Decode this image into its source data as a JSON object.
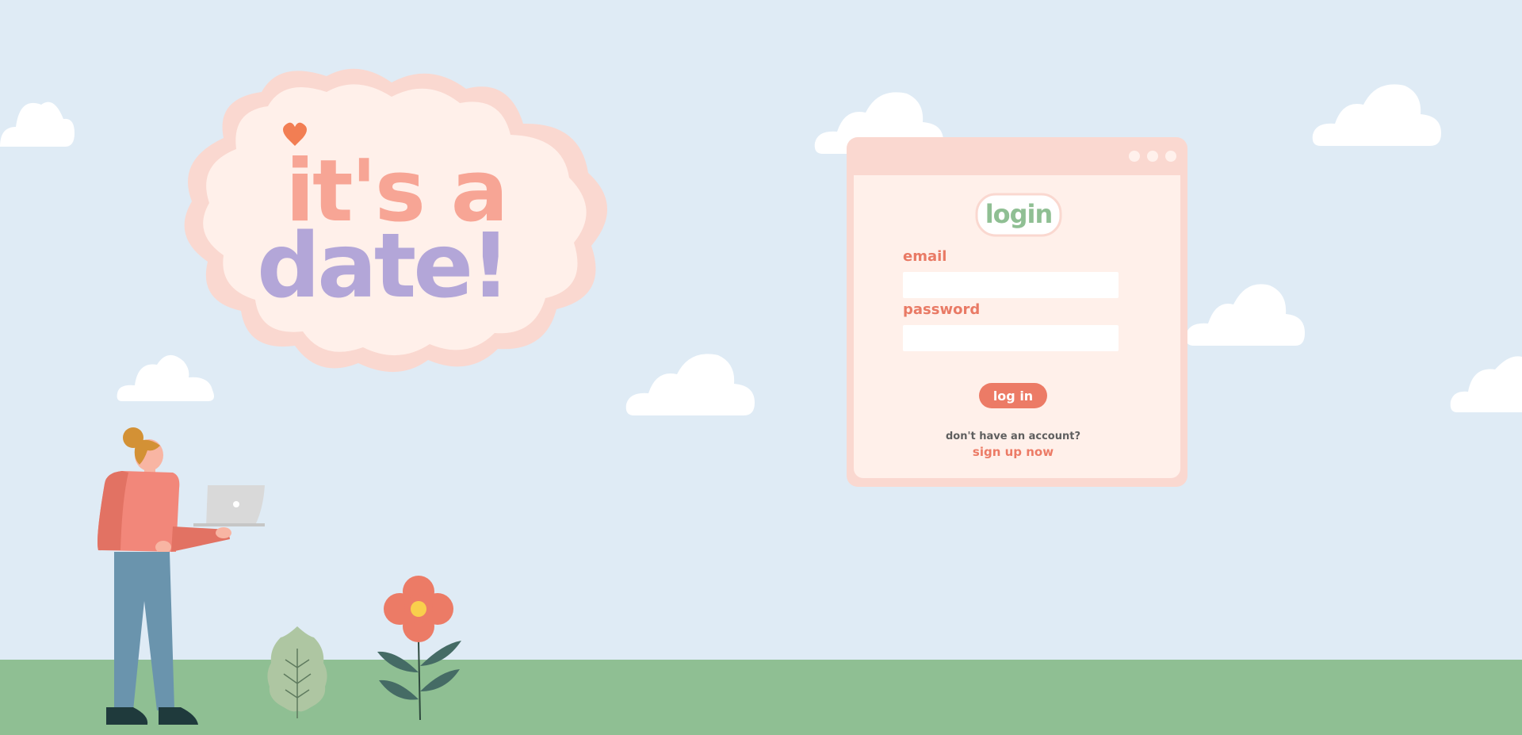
{
  "hero": {
    "title_line1": "it's a",
    "title_line2": "date!"
  },
  "login": {
    "logo_text": "login",
    "email_label": "email",
    "email_value": "",
    "email_placeholder": "",
    "password_label": "password",
    "password_value": "",
    "password_placeholder": "",
    "submit_label": "log in",
    "no_account_text": "don't have an account?",
    "signup_label": "sign up now"
  },
  "colors": {
    "sky": "#dfebf5",
    "ground": "#8fbf93",
    "accent": "#ec7b66",
    "window_frame": "#fad8d0",
    "window_body": "#fff0ea",
    "letter_purple": "#b3a6d8",
    "letter_blue": "#8fd4f6",
    "letter_green": "#8fbf93",
    "letter_yellow": "#f9d95e",
    "letter_pink": "#f7a595",
    "heart_orange": "#f27e53"
  },
  "icons": [
    "heart-icon",
    "window-dot-icon",
    "laptop-icon",
    "cloud-icon",
    "flower-icon",
    "leaf-icon"
  ]
}
